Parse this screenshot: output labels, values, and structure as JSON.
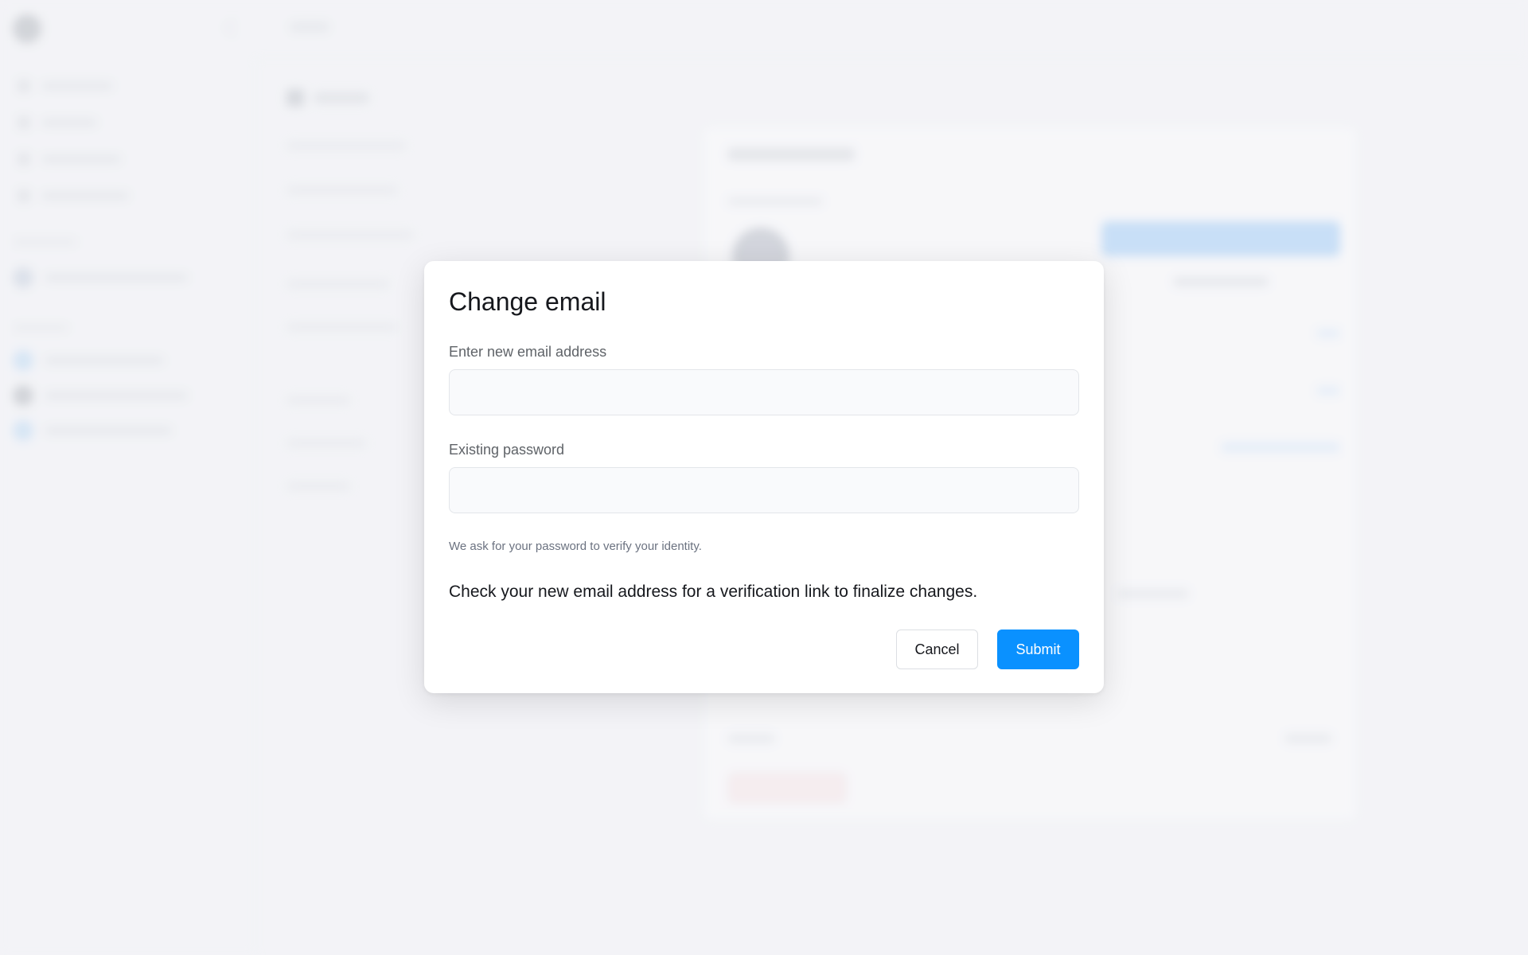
{
  "background": {
    "sidebar": {
      "items": [
        "",
        "",
        "",
        ""
      ],
      "sections": [
        "",
        ""
      ]
    },
    "topbar": {
      "crumb": ""
    },
    "settings_title": "",
    "card_title": ""
  },
  "modal": {
    "title": "Change email",
    "email_label": "Enter new email address",
    "email_value": "",
    "password_label": "Existing password",
    "password_value": "",
    "hint": "We ask for your password to verify your identity.",
    "info": "Check your new email address for a verification link to finalize changes.",
    "cancel_label": "Cancel",
    "submit_label": "Submit"
  },
  "colors": {
    "primary": "#0a91ff",
    "text": "#16181d",
    "muted": "#5f6368",
    "overlay": "#eef0f3"
  }
}
